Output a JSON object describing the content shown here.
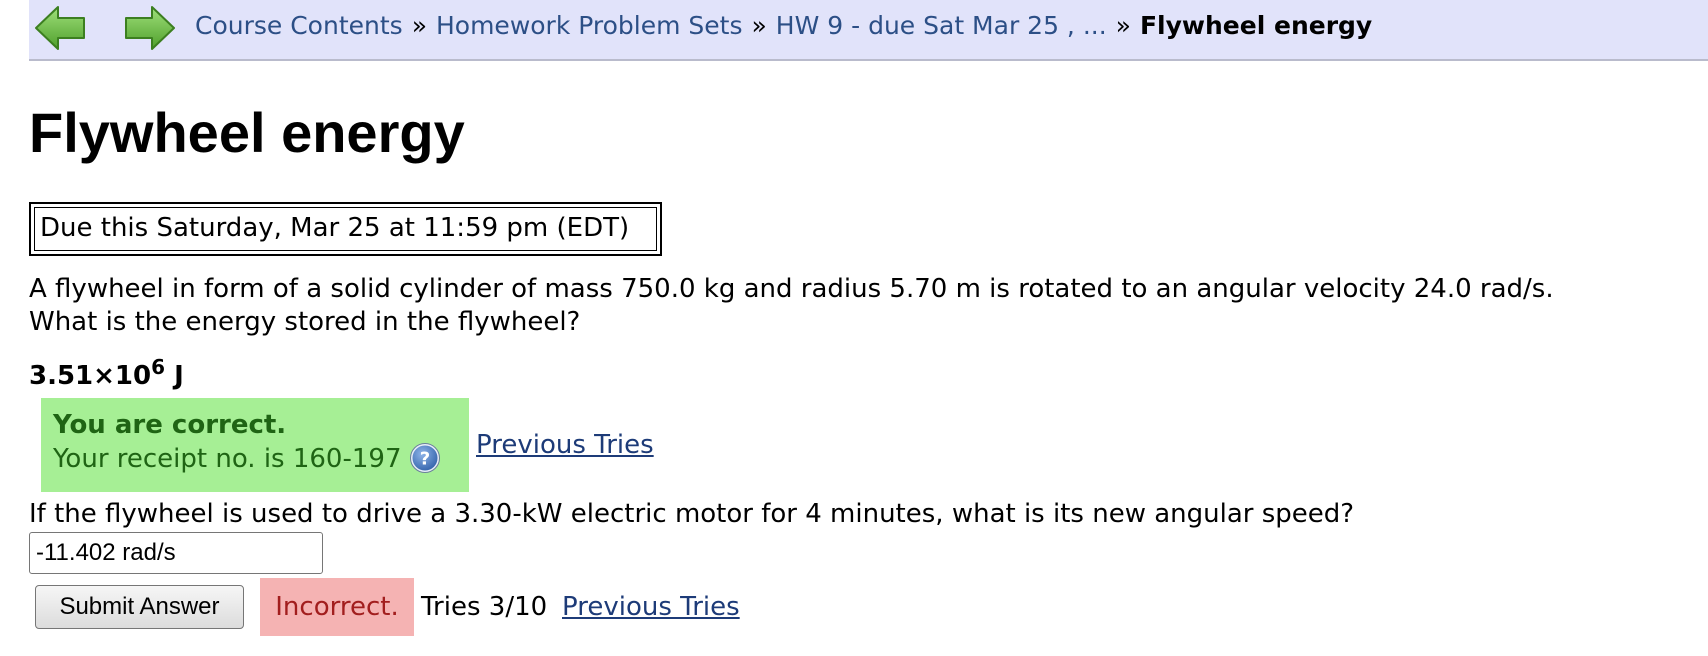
{
  "navbar": {
    "back_icon": "green-left-arrow-icon",
    "forward_icon": "green-right-arrow-icon",
    "breadcrumb": [
      {
        "label": "Course Contents"
      },
      {
        "label": "Homework Problem Sets"
      },
      {
        "label": "HW 9 - due Sat Mar 25 , ..."
      }
    ],
    "separator": "»",
    "current": "Flywheel energy"
  },
  "page_title": "Flywheel energy",
  "due_notice": "Due this Saturday, Mar 25 at 11:59 pm (EDT)",
  "problem": {
    "part1": {
      "question_line1": "A flywheel in form of a solid cylinder of mass 750.0 kg and radius 5.70 m is rotated to an angular velocity 24.0 rad/s.",
      "question_line2": "What is the energy stored in the flywheel?",
      "answer_mantissa": "3.51×10",
      "answer_exponent": "6",
      "answer_unit": "J",
      "status_title": "You are correct.",
      "receipt_text": "Your receipt no. is 160-197",
      "help_icon": "question-mark-help-icon",
      "previous_tries_label": "Previous Tries"
    },
    "part2": {
      "question": "If the flywheel is used to drive a 3.30-kW electric motor for 4 minutes, what is its new angular speed?",
      "input_value": "-11.402 rad/s",
      "submit_label": "Submit Answer",
      "status": "Incorrect.",
      "tries": "Tries 3/10",
      "previous_tries_label": "Previous Tries"
    }
  },
  "colors": {
    "navbar_bg": "#e1e3fa",
    "link": "#2c4f86",
    "correct_bg": "#a6ef95",
    "correct_text": "#1f6414",
    "incorrect_bg": "#f5b3b3",
    "incorrect_text": "#a21e1e"
  }
}
